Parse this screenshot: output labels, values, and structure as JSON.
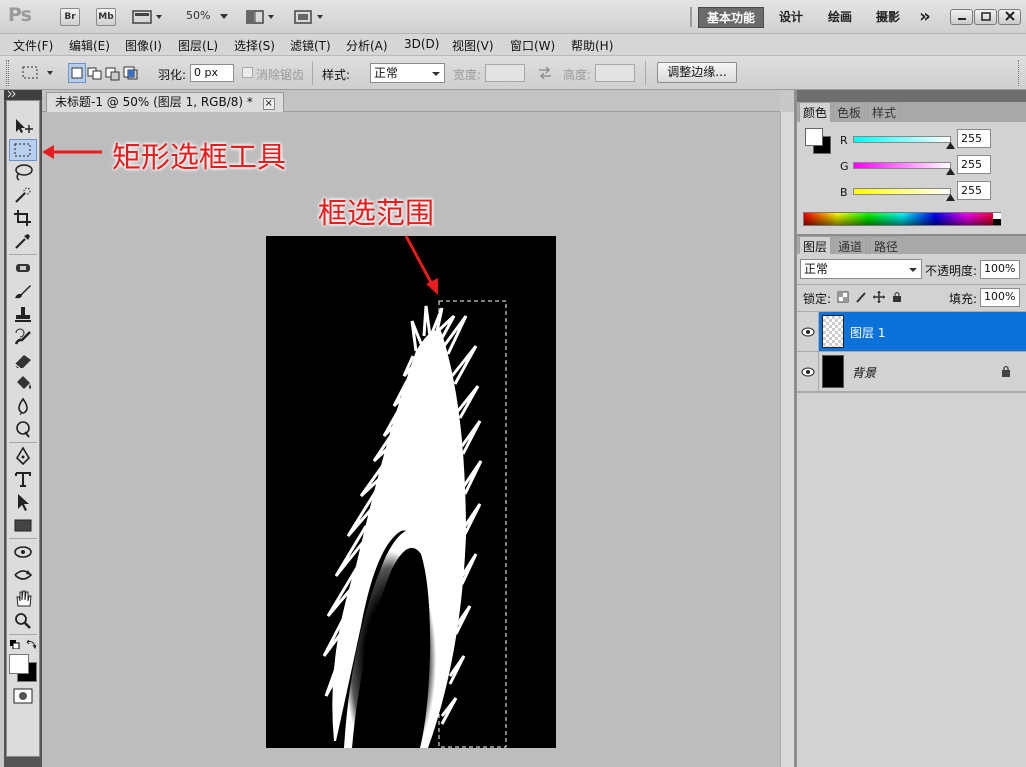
{
  "app": {
    "logo": "Ps",
    "bridge_label": "Br",
    "minibridge_label": "Mb",
    "zoom": "50%",
    "workspaces": [
      "基本功能",
      "设计",
      "绘画",
      "摄影"
    ],
    "more_label": "»"
  },
  "menu": [
    "文件(F)",
    "编辑(E)",
    "图像(I)",
    "图层(L)",
    "选择(S)",
    "滤镜(T)",
    "分析(A)",
    "3D(D)",
    "视图(V)",
    "窗口(W)",
    "帮助(H)"
  ],
  "options": {
    "feather_label": "羽化:",
    "feather_value": "0 px",
    "antialias_label": "消除锯齿",
    "style_label": "样式:",
    "style_value": "正常",
    "width_label": "宽度:",
    "height_label": "高度:",
    "refine_button": "调整边缘..."
  },
  "document": {
    "tab_title": "未标题-1 @ 50% (图层 1, RGB/8) *",
    "close_label": "×"
  },
  "color_panel": {
    "tabs": [
      "颜色",
      "色板",
      "样式"
    ],
    "channels": [
      {
        "label": "R",
        "value": "255"
      },
      {
        "label": "G",
        "value": "255"
      },
      {
        "label": "B",
        "value": "255"
      }
    ]
  },
  "layers_panel": {
    "tabs": [
      "图层",
      "通道",
      "路径"
    ],
    "blend_mode": "正常",
    "opacity_label": "不透明度:",
    "opacity_value": "100%",
    "lock_label": "锁定:",
    "fill_label": "填充:",
    "fill_value": "100%",
    "layers": [
      {
        "name": "图层 1",
        "selected": true
      },
      {
        "name": "背景",
        "selected": false
      }
    ]
  },
  "annotations": {
    "tool_note": "矩形选框工具",
    "selection_note": "框选范围"
  },
  "colors": {
    "accent": "#0a72d9",
    "annotation": "#e81c1c",
    "canvas_bg": "#000000",
    "feather": "#ffffff"
  }
}
